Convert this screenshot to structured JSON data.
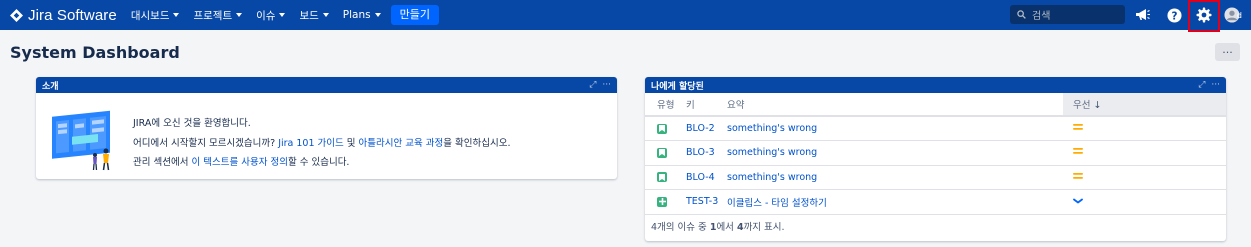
{
  "nav": {
    "logo": "Jira Software",
    "items": [
      {
        "label": "대시보드",
        "dropdown": true
      },
      {
        "label": "프로젝트",
        "dropdown": true
      },
      {
        "label": "이슈",
        "dropdown": true
      },
      {
        "label": "보드",
        "dropdown": true
      },
      {
        "label": "Plans",
        "dropdown": true
      }
    ],
    "create_label": "만들기",
    "search_placeholder": "검색",
    "icons": [
      "megaphone-icon",
      "help-icon",
      "gear-icon",
      "avatar"
    ],
    "highlighted_icon": "gear-icon",
    "avatar_alt": "d"
  },
  "page": {
    "title": "System Dashboard",
    "more": "···"
  },
  "intro": {
    "title": "소개",
    "tools": {
      "expand": "⤢",
      "more": "···"
    },
    "line1": "JIRA에 오신 것을 환영합니다.",
    "line2_a": "어디에서 시작할지 모르시겠습니까? ",
    "line2_link1": "Jira 101 가이드",
    "line2_b": " 및 ",
    "line2_link2": "아틀라시안 교육 과정",
    "line2_c": "을 확인하십시오.",
    "line3_a": "관리 섹션에서 ",
    "line3_link": "이 텍스트를 사용자 정의",
    "line3_b": "할 수 있습니다."
  },
  "assigned": {
    "title": "나에게 할당된",
    "tools": {
      "expand": "⤢",
      "more": "···"
    },
    "columns": {
      "type": "유형",
      "key": "키",
      "summary": "요약",
      "priority": "우선"
    },
    "rows": [
      {
        "type": "story",
        "key": "BLO-2",
        "summary": "something's wrong",
        "priority": "medium"
      },
      {
        "type": "story",
        "key": "BLO-3",
        "summary": "something's wrong",
        "priority": "medium"
      },
      {
        "type": "story",
        "key": "BLO-4",
        "summary": "something's wrong",
        "priority": "medium"
      },
      {
        "type": "new-feature",
        "key": "TEST-3",
        "summary": "이클립스 - 타임 설정하기",
        "priority": "low"
      }
    ],
    "footer": {
      "a": "4개의 이슈 중 ",
      "from": "1",
      "b": "에서 ",
      "to": "4",
      "c": "까지 표시."
    }
  },
  "colors": {
    "nav_bg": "#0747a6",
    "accent": "#0052cc",
    "story": "#36b37e",
    "priority_medium": "#ffab00",
    "priority_low": "#0065ff",
    "highlight": "#e0001b"
  }
}
